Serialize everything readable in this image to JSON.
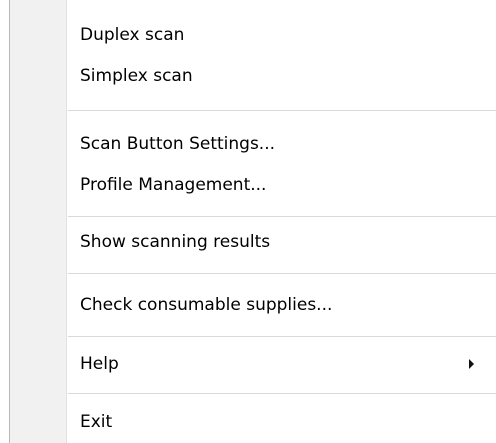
{
  "menu": {
    "items": [
      {
        "label": "Duplex scan"
      },
      {
        "label": "Simplex scan"
      },
      {
        "label": "Scan Button Settings..."
      },
      {
        "label": "Profile Management..."
      },
      {
        "label": "Show scanning results"
      },
      {
        "label": "Check consumable supplies..."
      },
      {
        "label": "Help",
        "icon": "chevron-right-icon"
      },
      {
        "label": "Exit"
      }
    ]
  },
  "colors": {
    "gutter": "#f1f1f1",
    "separator": "#d9d9d9",
    "border": "#b9b9b9",
    "text": "#000000"
  }
}
